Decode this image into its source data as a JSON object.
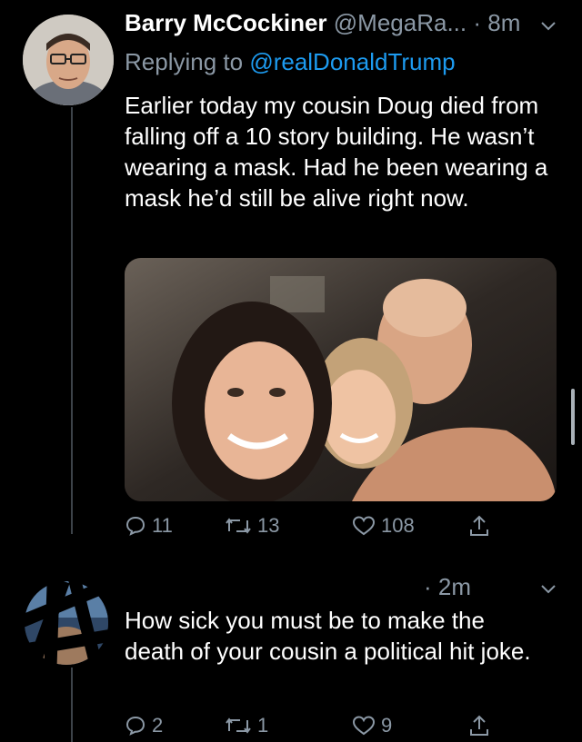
{
  "tweet1": {
    "display_name": "Barry McCockiner",
    "handle": "@MegaRa...",
    "time": "· 8m",
    "replying_prefix": "Replying to",
    "replying_handle": "@realDonaldTrump",
    "text": "Earlier today my cousin Doug died from falling off a 10 story building. He wasn’t wearing a mask. Had he been wearing a mask he’d still be alive right now.",
    "stats": {
      "replies": "11",
      "retweets": "13",
      "likes": "108"
    }
  },
  "tweet2": {
    "time": "· 2m",
    "text": "How sick you must be to make the death of your cousin a political hit joke.",
    "stats": {
      "replies": "2",
      "retweets": "1",
      "likes": "9"
    }
  },
  "icons": {
    "reply": "speech-bubble-icon",
    "retweet": "retweet-arrows-icon",
    "like": "heart-icon",
    "share": "share-upload-icon",
    "more": "chevron-down-icon"
  },
  "colors": {
    "link": "#1d9bf0",
    "muted": "#8b98a5",
    "background": "#000000",
    "thread_line": "#3d4349"
  }
}
